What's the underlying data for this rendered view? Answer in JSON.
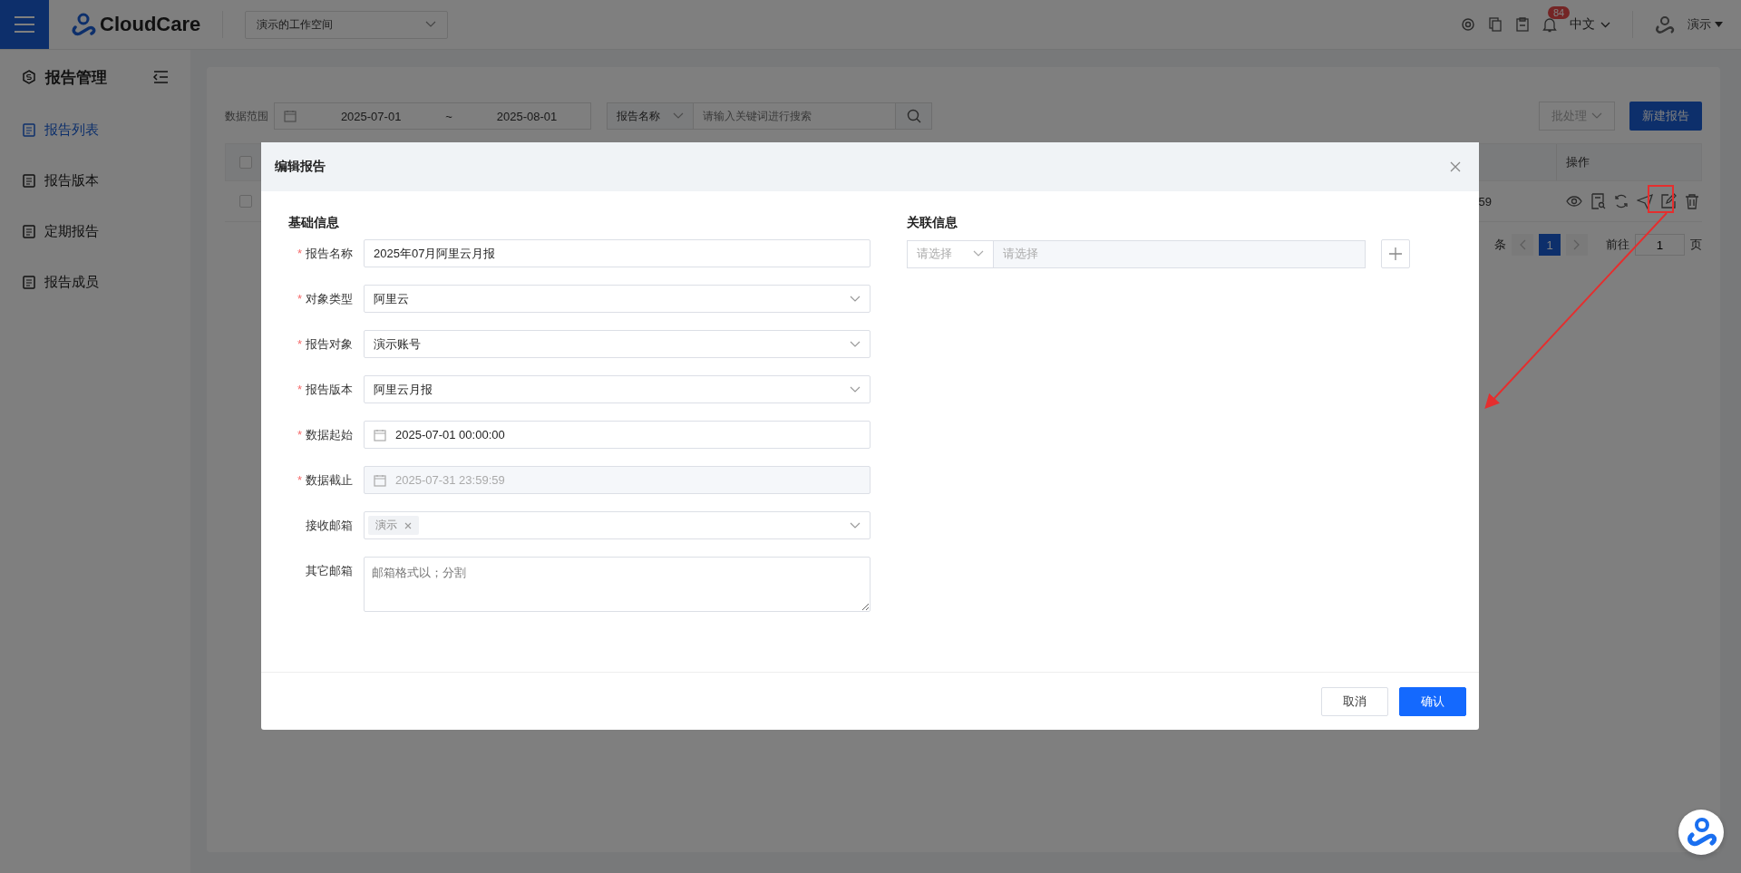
{
  "header": {
    "logo": "CloudCare",
    "workspace": "演示的工作空间",
    "notification_count": "84",
    "language": "中文",
    "user": "演示"
  },
  "sidebar": {
    "title": "报告管理",
    "items": [
      {
        "label": "报告列表",
        "selected": true
      },
      {
        "label": "报告版本",
        "selected": false
      },
      {
        "label": "定期报告",
        "selected": false
      },
      {
        "label": "报告成员",
        "selected": false
      }
    ]
  },
  "toolbar": {
    "range_label": "数据范围",
    "date_start": "2025-07-01",
    "separator": "~",
    "date_end": "2025-08-01",
    "search_by": "报告名称",
    "search_placeholder": "请输入关键词进行搜索",
    "batch_button": "批处理",
    "batch_disabled": true,
    "new_button": "新建报告"
  },
  "table": {
    "header_checked": false,
    "action_column": "操作",
    "rows": [
      {
        "checked": false,
        "column_3": "59"
      }
    ]
  },
  "pagination": {
    "total_suffix": "条",
    "current_page": "1",
    "goto_label": "前往",
    "goto_value": "1",
    "page_suffix": "页"
  },
  "dialog": {
    "title": "编辑报告",
    "basic_section": "基础信息",
    "required_mark": "*",
    "fields": [
      {
        "kind": "text",
        "label": "报告名称",
        "required": true,
        "value": "2025年07月阿里云月报"
      },
      {
        "kind": "select",
        "label": "对象类型",
        "required": true,
        "value": "阿里云"
      },
      {
        "kind": "select",
        "label": "报告对象",
        "required": true,
        "value": "演示账号"
      },
      {
        "kind": "select",
        "label": "报告版本",
        "required": true,
        "value": "阿里云月报"
      },
      {
        "kind": "date",
        "label": "数据起始",
        "required": true,
        "value": "2025-07-01 00:00:00",
        "disabled": false
      },
      {
        "kind": "date",
        "label": "数据截止",
        "required": true,
        "value": "2025-07-31 23:59:59",
        "disabled": true
      },
      {
        "kind": "tags",
        "label": "接收邮箱",
        "required": false,
        "tags": [
          "演示"
        ]
      },
      {
        "kind": "textarea",
        "label": "其它邮箱",
        "required": false,
        "placeholder": "邮箱格式以；分割"
      }
    ],
    "related_section": "关联信息",
    "related": {
      "type_placeholder": "请选择",
      "value_placeholder": "请选择"
    },
    "buttons": [
      {
        "kind": "secondary",
        "label": "取消"
      },
      {
        "kind": "primary",
        "label": "确认"
      }
    ]
  }
}
